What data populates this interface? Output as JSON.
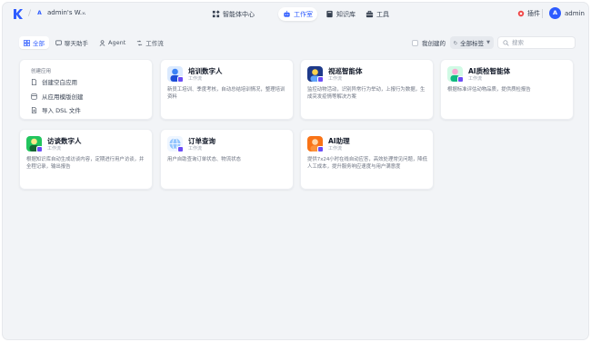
{
  "header": {
    "workspace_initial": "A",
    "workspace_name": "admin's W...",
    "nav": [
      {
        "label": "智能体中心",
        "icon": "sparkle-icon"
      },
      {
        "label": "工作室",
        "icon": "robot-icon",
        "active": true
      },
      {
        "label": "知识库",
        "icon": "book-icon"
      },
      {
        "label": "工具",
        "icon": "toolbox-icon"
      }
    ],
    "plugin_label": "插件",
    "user_initial": "A",
    "user_name": "admin"
  },
  "filters": {
    "tabs": [
      {
        "label": "全部",
        "icon": "grid-icon",
        "active": true
      },
      {
        "label": "聊天助手",
        "icon": "chat-icon"
      },
      {
        "label": "Agent",
        "icon": "agent-icon"
      },
      {
        "label": "工作流",
        "icon": "workflow-icon"
      }
    ],
    "mine_label": "我创建的",
    "tags_label": "全部标签",
    "search_placeholder": "搜索"
  },
  "create": {
    "title": "创建应用",
    "items": [
      {
        "label": "创建空白应用",
        "icon": "file-plus-icon"
      },
      {
        "label": "从应用模版创建",
        "icon": "template-icon"
      },
      {
        "label": "导入 DSL 文件",
        "icon": "import-icon"
      }
    ]
  },
  "apps": [
    {
      "name": "培训数字人",
      "type": "工作流",
      "desc": "新员工培训、季度考核，自动总结培训情况，整理培训资料",
      "icon": "trainer-avatar-icon",
      "color": "#3b82f6"
    },
    {
      "name": "视巡智能体",
      "type": "工作流",
      "desc": "监控动物活动，识别异常行为举动，上报行为数据，生成突发疫情等解决方案",
      "icon": "patrol-avatar-icon",
      "color": "#1e3a8a"
    },
    {
      "name": "AI质检智能体",
      "type": "工作流",
      "desc": "根据标准评估动物品质，提供质检报告",
      "icon": "inspector-avatar-icon",
      "color": "#10b981"
    },
    {
      "name": "访谈数字人",
      "type": "工作流",
      "desc": "根据知识库自动生成访谈内容，定期进行用户访谈，并全程记录，输出报告",
      "icon": "interview-avatar-icon",
      "color": "#16a34a"
    },
    {
      "name": "订单查询",
      "type": "工作流",
      "desc": "用户自助查询订单状态、物流状态",
      "icon": "order-globe-icon",
      "color": "#60a5fa"
    },
    {
      "name": "AI助理",
      "type": "工作流",
      "desc": "提供7x24小时在线自动应答，高效处理常见问题，降低人工成本，提升服务响应速度与用户满意度",
      "icon": "assistant-avatar-icon",
      "color": "#f97316"
    }
  ]
}
